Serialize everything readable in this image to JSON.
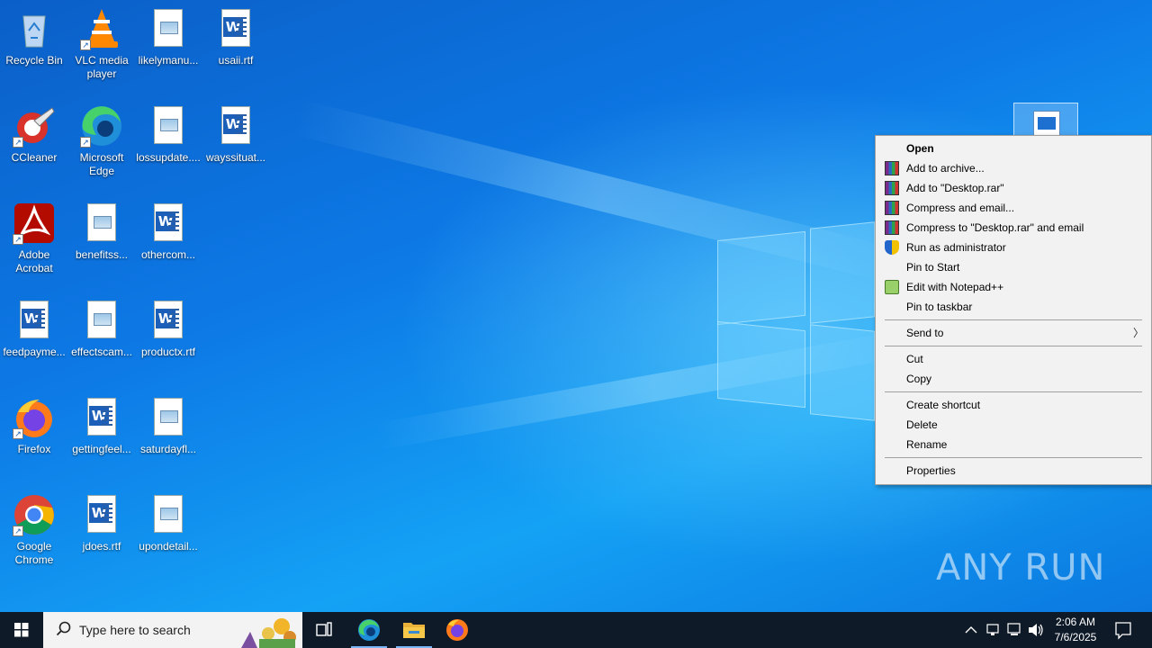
{
  "desktop": {
    "icons": [
      {
        "label": "Recycle Bin",
        "icon": "recycle-bin-icon"
      },
      {
        "label": "VLC media player",
        "icon": "vlc-icon"
      },
      {
        "label": "likelymanu...",
        "icon": "image-file-icon"
      },
      {
        "label": "usaii.rtf",
        "icon": "word-file-icon"
      },
      {
        "label": "CCleaner",
        "icon": "ccleaner-icon"
      },
      {
        "label": "Microsoft Edge",
        "icon": "edge-icon"
      },
      {
        "label": "lossupdate....",
        "icon": "image-file-icon"
      },
      {
        "label": "wayssituat...",
        "icon": "word-file-icon"
      },
      {
        "label": "Adobe Acrobat",
        "icon": "acrobat-icon"
      },
      {
        "label": "benefitss...",
        "icon": "image-file-icon"
      },
      {
        "label": "othercom...",
        "icon": "word-file-icon"
      },
      {
        "label": "feedpayme...",
        "icon": "word-file-icon"
      },
      {
        "label": "effectscam...",
        "icon": "image-file-icon"
      },
      {
        "label": "productx.rtf",
        "icon": "word-file-icon"
      },
      {
        "label": "Firefox",
        "icon": "firefox-icon"
      },
      {
        "label": "gettingfeel...",
        "icon": "word-file-icon"
      },
      {
        "label": "saturdayfl...",
        "icon": "image-file-icon"
      },
      {
        "label": "Google Chrome",
        "icon": "chrome-icon"
      },
      {
        "label": "jdoes.rtf",
        "icon": "word-file-icon"
      },
      {
        "label": "upondetail...",
        "icon": "image-file-icon"
      }
    ]
  },
  "context_menu": {
    "items": [
      {
        "label": "Open",
        "bold": true,
        "icon": ""
      },
      {
        "label": "Add to archive...",
        "icon": "winrar-icon"
      },
      {
        "label": "Add to \"Desktop.rar\"",
        "icon": "winrar-icon"
      },
      {
        "label": "Compress and email...",
        "icon": "winrar-icon"
      },
      {
        "label": "Compress to \"Desktop.rar\" and email",
        "icon": "winrar-icon"
      },
      {
        "label": "Run as administrator",
        "icon": "uac-shield-icon"
      },
      {
        "label": "Pin to Start",
        "icon": ""
      },
      {
        "label": "Edit with Notepad++",
        "icon": "notepadpp-icon"
      },
      {
        "label": "Pin to taskbar",
        "icon": ""
      },
      {
        "separator": true
      },
      {
        "label": "Send to",
        "icon": "",
        "submenu": true
      },
      {
        "separator": true
      },
      {
        "label": "Cut",
        "icon": ""
      },
      {
        "label": "Copy",
        "icon": ""
      },
      {
        "separator": true
      },
      {
        "label": "Create shortcut",
        "icon": ""
      },
      {
        "label": "Delete",
        "icon": ""
      },
      {
        "label": "Rename",
        "icon": ""
      },
      {
        "separator": true
      },
      {
        "label": "Properties",
        "icon": ""
      }
    ]
  },
  "taskbar": {
    "search_placeholder": "Type here to search",
    "pinned": [
      "task-view-icon",
      "edge-icon",
      "file-explorer-icon",
      "firefox-icon"
    ],
    "clock_time": "2:06 AM",
    "clock_date": "7/6/2025"
  },
  "watermark": "ANY RUN"
}
